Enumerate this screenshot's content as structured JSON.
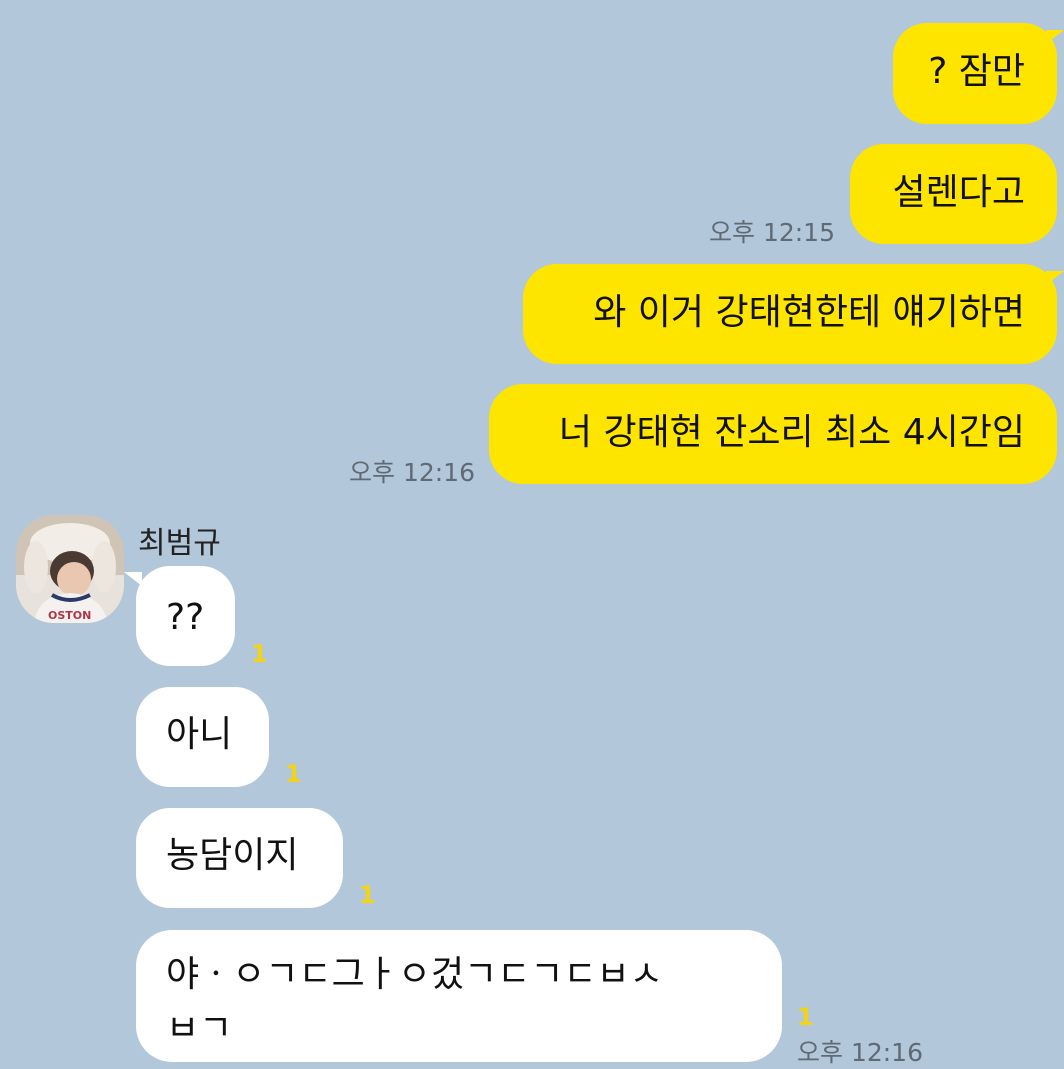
{
  "sender_name": "최범규",
  "outgoing": [
    {
      "text": "? 잠만"
    },
    {
      "text": "설렌다고"
    },
    {
      "text": "와 이거 강태현한테 얘기하면"
    },
    {
      "text": "너 강태현 잔소리 최소 4시간임"
    }
  ],
  "incoming": [
    {
      "text": "??",
      "unread": "1"
    },
    {
      "text": "아니",
      "unread": "1"
    },
    {
      "text": "농담이지",
      "unread": "1"
    },
    {
      "text": "야ㆍㅇㄱㄷ그ㅏㅇ겄ㄱㄷㄱㄷㅂㅅ",
      "text2": "ㅂㄱ",
      "unread": "1"
    }
  ],
  "times": {
    "t1": "오후 12:15",
    "t2": "오후 12:16",
    "t3": "오후 12:16"
  },
  "avatar_shirt_text": "OSTON",
  "colors": {
    "background": "#b2c7da",
    "outgoing_bubble": "#fee500",
    "incoming_bubble": "#ffffff",
    "unread": "#f3d317"
  }
}
